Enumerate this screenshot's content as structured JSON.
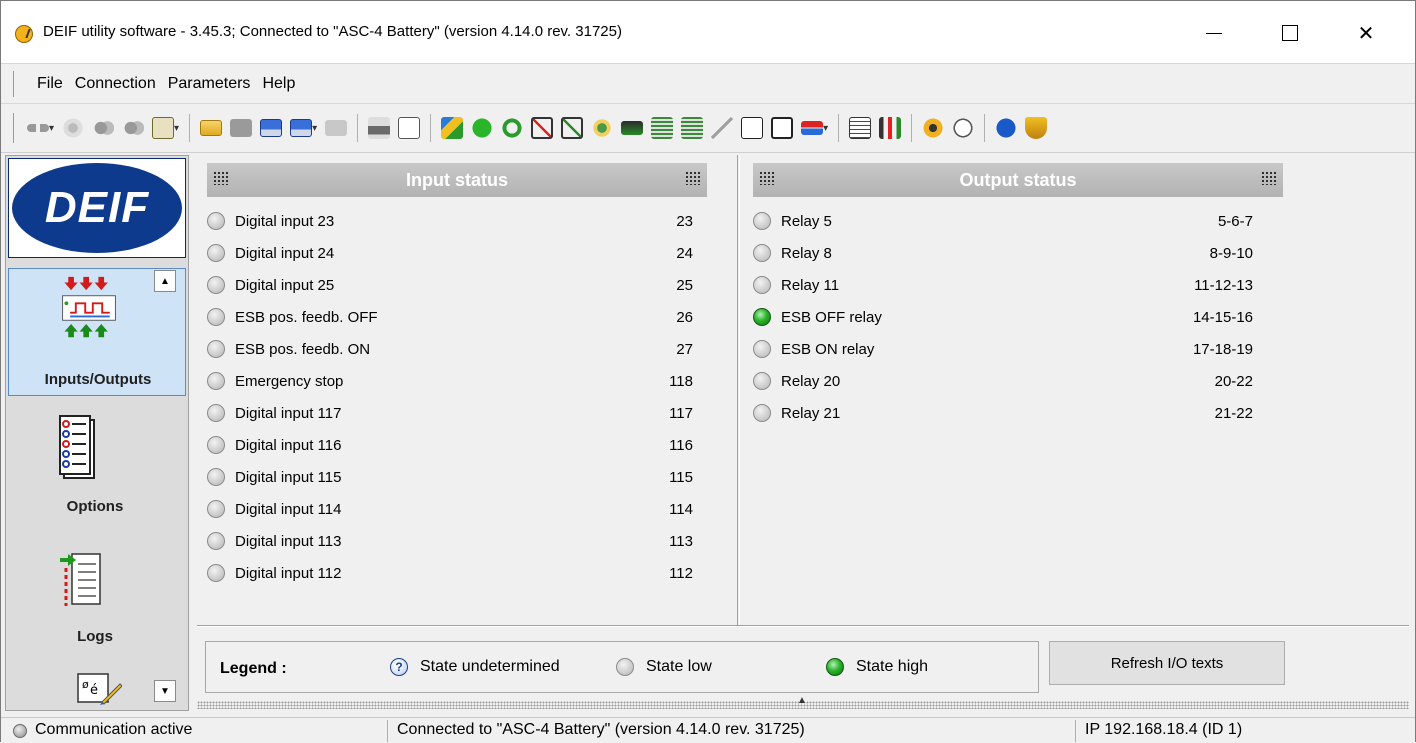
{
  "window": {
    "title": "DEIF utility software - 3.45.3; Connected to \"ASC-4 Battery\" (version 4.14.0 rev. 31725)",
    "close_glyph": "✕"
  },
  "menu": [
    "File",
    "Connection",
    "Parameters",
    "Help"
  ],
  "nav": {
    "logo_text": "DEIF",
    "items": [
      "Inputs/Outputs",
      "Options",
      "Logs"
    ],
    "scroll_up": "▲",
    "scroll_down": "▼"
  },
  "input_status": {
    "header": "Input status",
    "rows": [
      {
        "label": "Digital input 23",
        "num": "23",
        "state": "low"
      },
      {
        "label": "Digital input 24",
        "num": "24",
        "state": "low"
      },
      {
        "label": "Digital input 25",
        "num": "25",
        "state": "low"
      },
      {
        "label": "ESB pos. feedb. OFF",
        "num": "26",
        "state": "low"
      },
      {
        "label": "ESB pos. feedb. ON",
        "num": "27",
        "state": "low"
      },
      {
        "label": "Emergency stop",
        "num": "118",
        "state": "low"
      },
      {
        "label": "Digital input 117",
        "num": "117",
        "state": "low"
      },
      {
        "label": "Digital input 116",
        "num": "116",
        "state": "low"
      },
      {
        "label": "Digital input 115",
        "num": "115",
        "state": "low"
      },
      {
        "label": "Digital input 114",
        "num": "114",
        "state": "low"
      },
      {
        "label": "Digital input 113",
        "num": "113",
        "state": "low"
      },
      {
        "label": "Digital input 112",
        "num": "112",
        "state": "low"
      }
    ]
  },
  "output_status": {
    "header": "Output status",
    "rows": [
      {
        "label": "Relay 5",
        "terminals": "5-6-7",
        "state": "low"
      },
      {
        "label": "Relay 8",
        "terminals": "8-9-10",
        "state": "low"
      },
      {
        "label": "Relay 11",
        "terminals": "11-12-13",
        "state": "low"
      },
      {
        "label": "ESB OFF relay",
        "terminals": "14-15-16",
        "state": "high"
      },
      {
        "label": "ESB ON relay",
        "terminals": "17-18-19",
        "state": "low"
      },
      {
        "label": "Relay 20",
        "terminals": "20-22",
        "state": "low"
      },
      {
        "label": "Relay 21",
        "terminals": "21-22",
        "state": "low"
      }
    ]
  },
  "legend": {
    "title": "Legend :",
    "undetermined": "State undetermined",
    "undetermined_glyph": "?",
    "low": "State low",
    "high": "State high"
  },
  "refresh_button": "Refresh I/O texts",
  "statusbar": {
    "comm": "Communication active",
    "connected": "Connected to \"ASC-4 Battery\" (version 4.14.0 rev. 31725)",
    "ip": "IP 192.168.18.4 (ID 1)"
  },
  "colors": {
    "state_high": "#2ab52a",
    "state_low": "#c8c8c8",
    "header_bg": "#b8b8b8",
    "active_nav": "#cfe3f7",
    "logo_blue": "#0d3a8c"
  },
  "toolbar_icons": [
    "connect-icon",
    "disconnect-icon",
    "read-icon",
    "write-icon",
    "password-icon",
    "open-icon",
    "new-icon",
    "save-icon",
    "save-as-icon",
    "import-icon",
    "print-icon",
    "print-preview-icon",
    "application-icon",
    "n-icon",
    "refresh-icon",
    "alarm-up-icon",
    "alarm-ack-icon",
    "settings-icon",
    "battery-icon",
    "log-icon",
    "log-2-icon",
    "trend-icon",
    "sum-icon",
    "id-icon",
    "transfer-icon",
    "parameter-list-icon",
    "io-chart-icon",
    "gear-icon",
    "timer-icon",
    "info-icon",
    "shield-icon"
  ]
}
